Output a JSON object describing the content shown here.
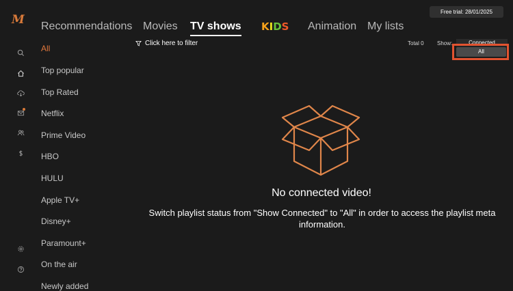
{
  "app": {
    "logo_text": "M"
  },
  "rail_icons": [
    "search-icon",
    "home-icon",
    "cloud-download-icon",
    "mail-icon",
    "users-icon",
    "dollar-icon",
    "settings-icon",
    "help-icon"
  ],
  "nav": {
    "tabs": [
      "Recommendations",
      "Movies",
      "TV shows",
      "Animation",
      "My lists"
    ],
    "active_tab": "TV shows",
    "kids_letters": [
      "K",
      "I",
      "D",
      "S"
    ],
    "kids_colors": [
      "#f7a21b",
      "#e8e21d",
      "#67c23a",
      "#f05a28"
    ]
  },
  "trial_badge": "Free trial: 28/01/2025",
  "toolbar": {
    "filter_label": "Click here to filter",
    "total_label": "Total 0",
    "show_label": "Show:",
    "show_current": "Connected",
    "show_option": "All"
  },
  "categories": [
    "All",
    "Top popular",
    "Top Rated",
    "Netflix",
    "Prime Video",
    "HBO",
    "HULU",
    "Apple TV+",
    "Disney+",
    "Paramount+",
    "On the air",
    "Newly added"
  ],
  "active_category": "All",
  "empty_state": {
    "title": "No connected video!",
    "description": "Switch playlist status from \"Show Connected\" to \"All\" in order to access the playlist meta information."
  },
  "colors": {
    "accent": "#e0773c",
    "highlight": "#e25330",
    "background": "#1b1b1b"
  }
}
